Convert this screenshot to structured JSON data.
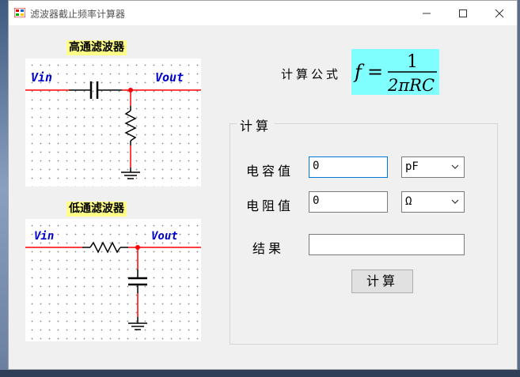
{
  "window": {
    "title": "滤波器截止频率计算器"
  },
  "highpass": {
    "title": "高通滤波器",
    "vin": "Vin",
    "vout": "Vout"
  },
  "lowpass": {
    "title": "低通滤波器",
    "vin": "Vin",
    "vout": "Vout"
  },
  "formula": {
    "label": "计算公式",
    "f": "f",
    "eq": "=",
    "numerator": "1",
    "denominator": "2πRC"
  },
  "group": {
    "title": "计算"
  },
  "capacitance": {
    "label": "电容值",
    "value": "0",
    "unit": "pF"
  },
  "resistance": {
    "label": "电阻值",
    "value": "0",
    "unit": "Ω"
  },
  "result": {
    "label": "结果",
    "value": ""
  },
  "calculate_button": "计算",
  "colors": {
    "wire": "#ff0000",
    "node": "#ff0000",
    "label": "#0000cc",
    "formula_bg": "#80ffff",
    "title_bg": "#ffff88"
  }
}
